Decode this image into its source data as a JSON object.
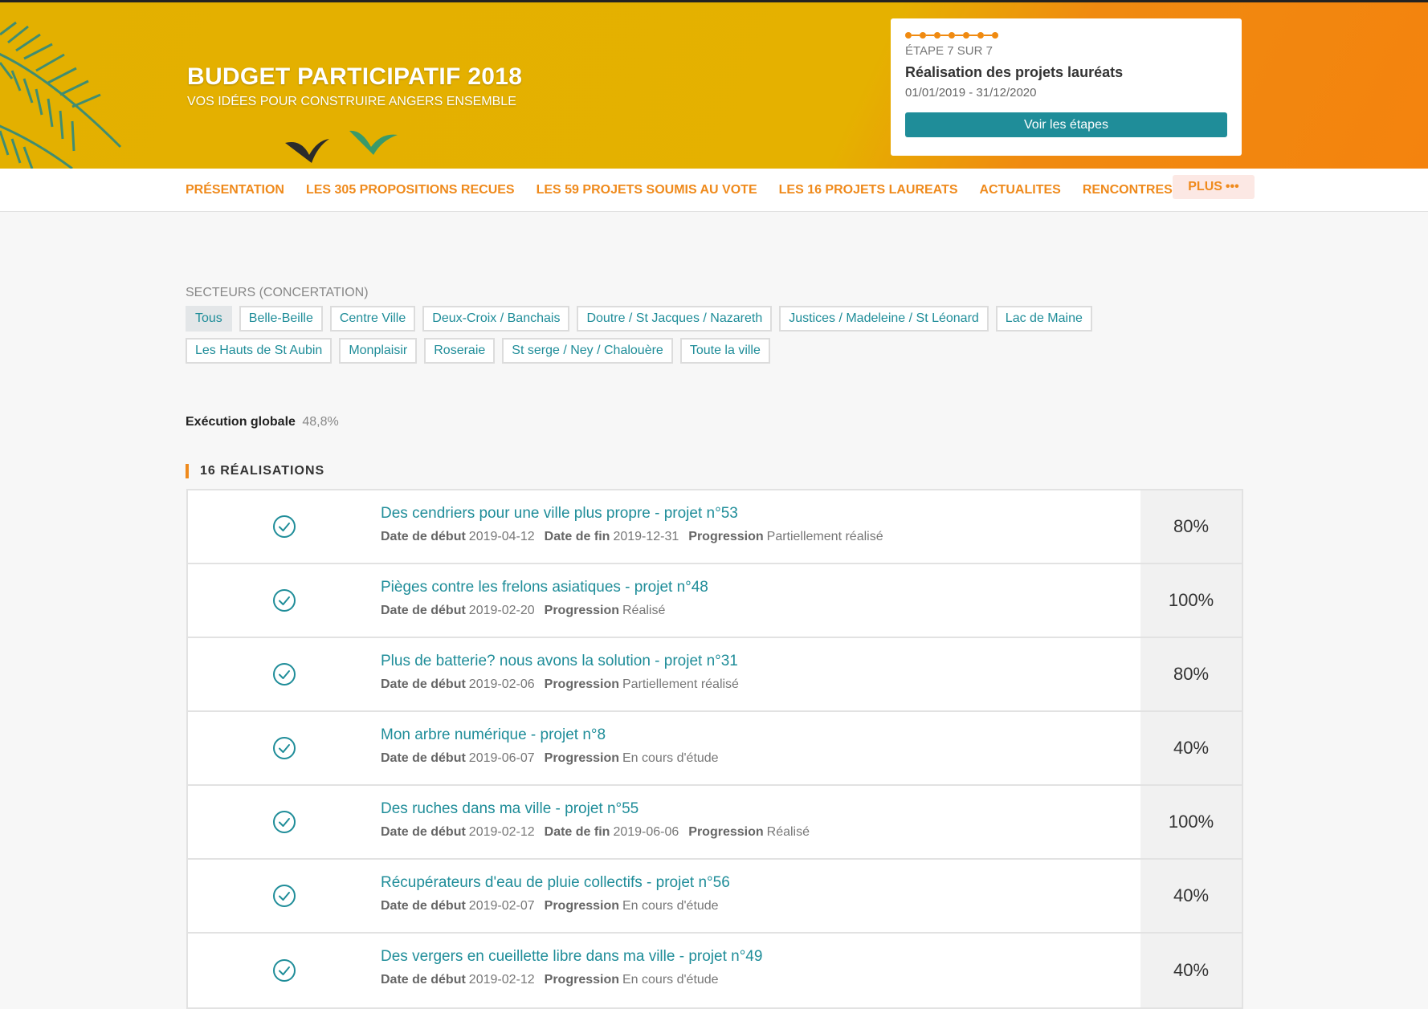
{
  "banner": {
    "title": "BUDGET PARTICIPATIF 2018",
    "subtitle": "VOS IDÉES POUR CONSTRUIRE ANGERS ENSEMBLE"
  },
  "step": {
    "label": "ÉTAPE 7 SUR 7",
    "title": "Réalisation des projets lauréats",
    "dates": "01/01/2019 - 31/12/2020",
    "button": "Voir les étapes",
    "dot_count": 7
  },
  "nav": {
    "items": [
      "PRÉSENTATION",
      "LES 305 PROPOSITIONS RECUES",
      "LES 59 PROJETS SOUMIS AU VOTE",
      "LES 16 PROJETS LAUREATS",
      "ACTUALITES",
      "RENCONTRES"
    ],
    "more": "PLUS"
  },
  "sectors": {
    "label": "SECTEURS (CONCERTATION)",
    "row1": [
      "Tous",
      "Belle-Beille",
      "Centre Ville",
      "Deux-Croix / Banchais",
      "Doutre / St Jacques / Nazareth",
      "Justices / Madeleine / St Léonard",
      "Lac de Maine"
    ],
    "row2": [
      "Les Hauts de St Aubin",
      "Monplaisir",
      "Roseraie",
      "St serge / Ney / Chalouère",
      "Toute la ville"
    ],
    "active": "Tous"
  },
  "execution": {
    "label": "Exécution globale",
    "value": "48,8%"
  },
  "realisations": {
    "title": "16 RÉALISATIONS",
    "labels": {
      "start": "Date de début",
      "end": "Date de fin",
      "progress": "Progression"
    },
    "items": [
      {
        "title": "Des cendriers pour une ville plus propre - projet n°53",
        "start": "2019-04-12",
        "end": "2019-12-31",
        "progress": "Partiellement réalisé",
        "percent": "80%"
      },
      {
        "title": "Pièges contre les frelons asiatiques - projet n°48",
        "start": "2019-02-20",
        "end": "",
        "progress": "Réalisé",
        "percent": "100%"
      },
      {
        "title": "Plus de batterie? nous avons la solution - projet n°31",
        "start": "2019-02-06",
        "end": "",
        "progress": "Partiellement réalisé",
        "percent": "80%"
      },
      {
        "title": "Mon arbre numérique - projet n°8",
        "start": "2019-06-07",
        "end": "",
        "progress": "En cours d'étude",
        "percent": "40%"
      },
      {
        "title": "Des ruches dans ma ville - projet n°55",
        "start": "2019-02-12",
        "end": "2019-06-06",
        "progress": "Réalisé",
        "percent": "100%"
      },
      {
        "title": "Récupérateurs d'eau de pluie collectifs - projet n°56",
        "start": "2019-02-07",
        "end": "",
        "progress": "En cours d'étude",
        "percent": "40%"
      },
      {
        "title": "Des vergers en cueillette libre dans ma ville - projet n°49",
        "start": "2019-02-12",
        "end": "",
        "progress": "En cours d'étude",
        "percent": "40%"
      }
    ]
  },
  "colors": {
    "accent_orange": "#ef8a1c",
    "link_teal": "#1f8d99",
    "banner_yellow": "#e3b000"
  }
}
